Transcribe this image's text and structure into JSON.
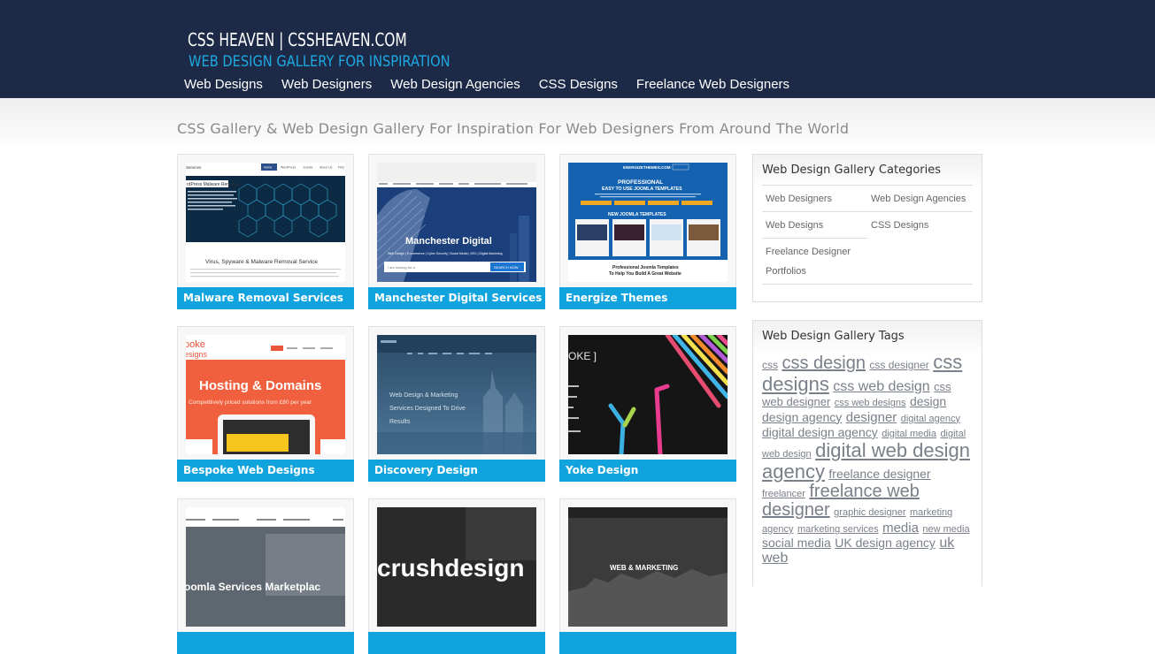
{
  "header": {
    "site_title": "CSS HEAVEN | CSSHEAVEN.COM",
    "tagline": "WEB DESIGN GALLERY FOR INSPIRATION",
    "nav": [
      "Web Designs",
      "Web Designers",
      "Web Design Agencies",
      "CSS Designs",
      "Freelance Web Designers"
    ]
  },
  "page_heading": "CSS Gallery & Web Design Gallery For Inspiration For Web Designers From Around The World",
  "gallery": [
    {
      "title": "Malware Removal Services",
      "thumb_text": [
        "Services",
        "Home",
        "WordPress",
        "Joomla",
        "About Us",
        "FAQ",
        "rdPress Malware Removal",
        "Virus, Spyware & Malware Removal Service"
      ]
    },
    {
      "title": "Manchester Digital Services",
      "thumb_text": [
        "Manchester Digital",
        "Web Design | E-commerce | Cyber Security | Social Media | SEO | Digital Marketing",
        "I am looking for a",
        "SEARCH NOW"
      ]
    },
    {
      "title": "Energize Themes",
      "thumb_text": [
        "ENERGIZETHEMES.COM",
        "PROFESSIONAL",
        "EASY TO USE JOOMLA TEMPLATES",
        "NEW JOOMLA TEMPLATES",
        "Professional Joomla Templates",
        "To Help You Build A Great Website"
      ]
    },
    {
      "title": "Bespoke Web Designs",
      "thumb_text": [
        "poke",
        "esigns",
        "Hosting & Domains",
        "Competitively priced solutions from £80 per year"
      ]
    },
    {
      "title": "Discovery Design",
      "thumb_text": [
        "Web Design & Marketing",
        "Services Designed To Drive",
        "Results"
      ]
    },
    {
      "title": "Yoke Design",
      "thumb_text": [
        "OKE ]"
      ]
    },
    {
      "title": "",
      "thumb_text": [
        "oomla Services Marketplac"
      ]
    },
    {
      "title": "",
      "thumb_text": [
        "crushdesign"
      ]
    },
    {
      "title": "",
      "thumb_text": [
        "WEB & MARKETING"
      ]
    }
  ],
  "categories_box": {
    "title": "Web Design Gallery Categories",
    "left": [
      "Web Designers",
      "Web Designs",
      "Freelance Designer",
      "Portfolios"
    ],
    "right": [
      "Web Design Agencies",
      "CSS Designs"
    ]
  },
  "tags_box": {
    "title": "Web Design Gallery Tags",
    "tags": [
      {
        "text": "css",
        "size": 12
      },
      {
        "text": "css design",
        "size": 20
      },
      {
        "text": "css designer",
        "size": 12
      },
      {
        "text": "css designs",
        "size": 22
      },
      {
        "text": "css web design",
        "size": 16
      },
      {
        "text": "css web designer",
        "size": 13
      },
      {
        "text": "css web designs",
        "size": 11
      },
      {
        "text": "design",
        "size": 14
      },
      {
        "text": "design agency",
        "size": 14
      },
      {
        "text": "designer",
        "size": 15
      },
      {
        "text": "digital agency",
        "size": 11
      },
      {
        "text": "digital design agency",
        "size": 14
      },
      {
        "text": "digital media",
        "size": 11
      },
      {
        "text": "digital web design",
        "size": 11
      },
      {
        "text": "digital web design agency",
        "size": 22
      },
      {
        "text": "freelance designer",
        "size": 14
      },
      {
        "text": "freelancer",
        "size": 11
      },
      {
        "text": "freelance web designer",
        "size": 20
      },
      {
        "text": "graphic designer",
        "size": 11
      },
      {
        "text": "marketing agency",
        "size": 11
      },
      {
        "text": "marketing services",
        "size": 11
      },
      {
        "text": "media",
        "size": 15
      },
      {
        "text": "new media",
        "size": 11
      },
      {
        "text": "social media",
        "size": 14
      },
      {
        "text": "UK design agency",
        "size": 14
      },
      {
        "text": "uk web",
        "size": 16
      }
    ]
  }
}
